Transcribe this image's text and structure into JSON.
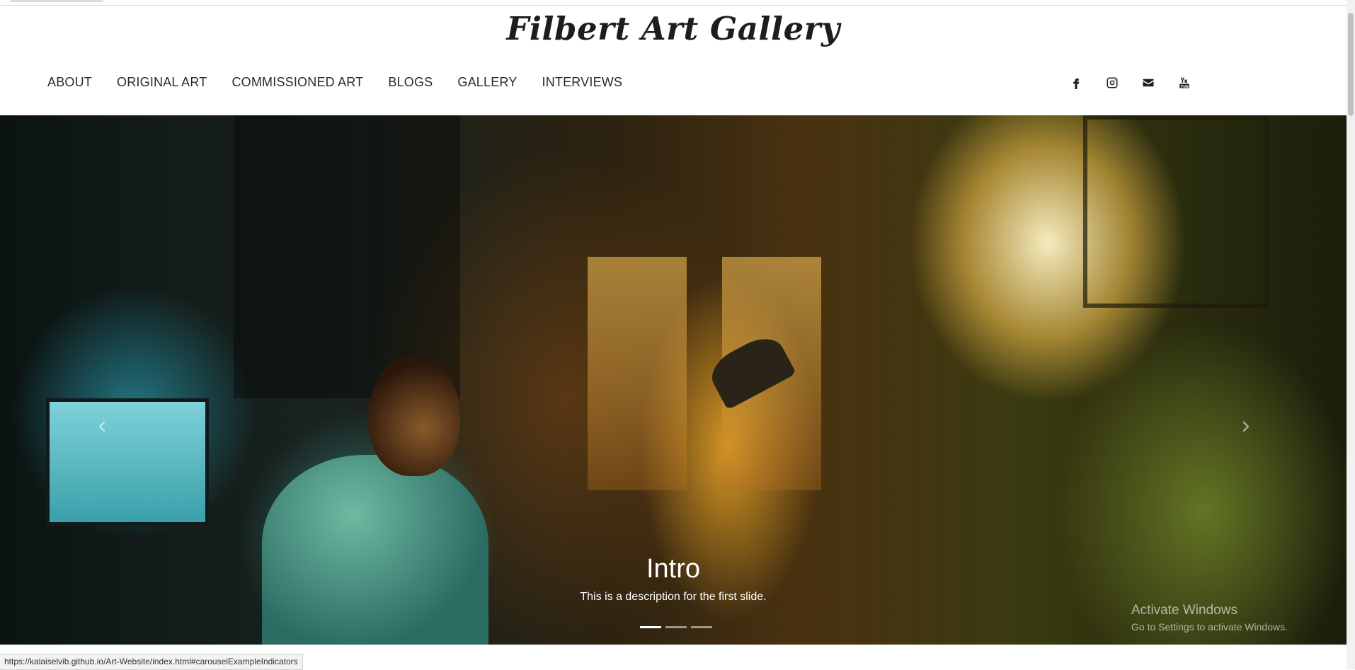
{
  "site": {
    "title": "Filbert Art Gallery"
  },
  "nav": {
    "items": [
      {
        "label": "ABOUT"
      },
      {
        "label": "ORIGINAL ART"
      },
      {
        "label": "COMMISSIONED ART"
      },
      {
        "label": "BLOGS"
      },
      {
        "label": "GALLERY"
      },
      {
        "label": "INTERVIEWS"
      }
    ]
  },
  "social": {
    "icons": [
      "facebook-icon",
      "instagram-icon",
      "envelope-icon",
      "youtube-icon"
    ]
  },
  "carousel": {
    "active_index": 0,
    "slide_count": 3,
    "caption": {
      "title": "Intro",
      "description": "This is a description for the first slide."
    }
  },
  "watermark": {
    "title": "Activate Windows",
    "subtitle": "Go to Settings to activate Windows."
  },
  "status_bar": {
    "url": "https://kalaiselvib.github.io/Art-Website/index.html#carouselExampleIndicators"
  },
  "colors": {
    "text": "#2b2b2b",
    "title": "#1d1d1d",
    "caption": "#ffffff"
  }
}
